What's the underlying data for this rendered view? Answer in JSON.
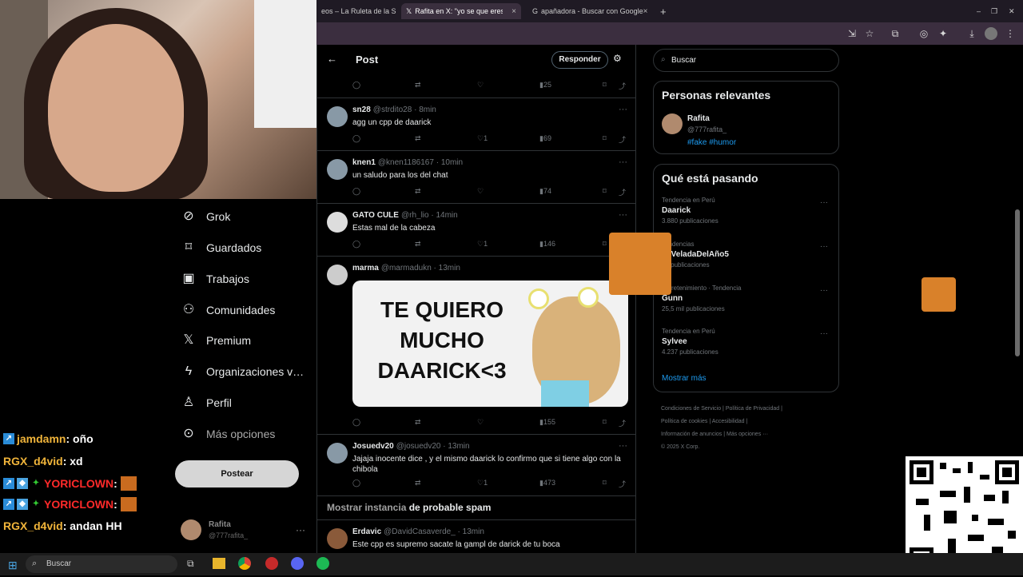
{
  "browser": {
    "tabs": [
      {
        "label": "eos – La Ruleta de la S…"
      },
      {
        "label": "Rafita en X: \"yo se que eres ino…"
      },
      {
        "label": "apañadora - Buscar con Google"
      }
    ],
    "new_tab": "+"
  },
  "header": {
    "title": "Post",
    "reply_button": "Responder"
  },
  "nav": {
    "items": [
      {
        "label": "Grok",
        "icon": "grok-icon"
      },
      {
        "label": "Guardados",
        "icon": "bookmark-icon"
      },
      {
        "label": "Trabajos",
        "icon": "briefcase-icon"
      },
      {
        "label": "Comunidades",
        "icon": "people-icon"
      },
      {
        "label": "Premium",
        "icon": "x-logo-icon"
      },
      {
        "label": "Organizaciones v…",
        "icon": "lightning-icon"
      },
      {
        "label": "Perfil",
        "icon": "person-icon"
      },
      {
        "label": "Más opciones",
        "icon": "more-circle-icon"
      }
    ],
    "post_button": "Postear",
    "account": {
      "name": "Rafita",
      "handle": "@777rafita_"
    }
  },
  "chat": [
    {
      "user": "jamdamn",
      "text": " : oño",
      "color": "#f0b43a"
    },
    {
      "user": "RGX_d4vid",
      "text": " : xd",
      "color": "#f0b43a"
    },
    {
      "user": "YORICLOWN",
      "text": " :",
      "color": "#ff2a2a"
    },
    {
      "user": "YORICLOWN",
      "text": " :",
      "color": "#ff2a2a"
    },
    {
      "user": "RGX_d4vid",
      "text": " : andan HH",
      "color": "#f0b43a"
    }
  ],
  "feed": {
    "top_actions": {
      "views": "25"
    },
    "posts": [
      {
        "name": "sn28",
        "handle": "@strdito28 · 8min",
        "text": "agg un cpp de daarick",
        "likes": "1",
        "views": "69"
      },
      {
        "name": "knen1",
        "handle": "@knen1186167 · 10min",
        "text": "un saludo para los del chat",
        "likes": "",
        "views": "74"
      },
      {
        "name": "GATO CULE",
        "handle": "@rh_lio · 14min",
        "text": "Estas mal de la cabeza",
        "likes": "1",
        "views": "146"
      },
      {
        "name": "marma",
        "handle": "@marmadukn · 13min",
        "text": "",
        "likes": "",
        "views": "155"
      },
      {
        "name": "Josuedv20",
        "handle": "@josuedv20 · 13min",
        "text": "Jajaja inocente dice , y el mismo daarick lo confirmo que si tiene algo con la chibola",
        "likes": "1",
        "views": "473"
      },
      {
        "name": "Erdavic",
        "handle": "@DavidCasaverde_ · 13min",
        "text": "Este cpp es supremo sacate la gampl de  darick de tu boca",
        "likes": "",
        "views": ""
      }
    ],
    "meme_text": [
      "TE QUIERO",
      "MUCHO",
      "DAARICK<3"
    ],
    "spam_link": "Mostrar instancia",
    "spam_rest": " de probable spam"
  },
  "right": {
    "search_placeholder": "Buscar",
    "relevant": {
      "title": "Personas relevantes",
      "name": "Rafita",
      "handle": "@777rafita_",
      "bio": "#fake #humor"
    },
    "trending": {
      "title": "Qué está pasando",
      "items": [
        {
          "context": "Tendencia en Perú",
          "name": "Daarick",
          "count": "3.880 publicaciones"
        },
        {
          "context": "Tendencias",
          "name": "LaVeladaDelAño5",
          "count": "53 publicaciones"
        },
        {
          "context": "Entretenimiento · Tendencia",
          "name": "Gunn",
          "count": "25,5 mil publicaciones"
        },
        {
          "context": "Tendencia en Perú",
          "name": "Sylvee",
          "count": "4.237 publicaciones"
        }
      ],
      "show_more": "Mostrar más"
    },
    "footer": [
      "Condiciones de Servicio",
      "Política de Privacidad",
      "Política de cookies",
      "Accesibilidad",
      "Información de anuncios",
      "Más opciones ···",
      "© 2025 X Corp."
    ]
  },
  "taskbar": {
    "search": "Buscar"
  },
  "colors": {
    "accent": "#1d9bf0",
    "border": "#2f3336",
    "muted": "#71767b"
  }
}
